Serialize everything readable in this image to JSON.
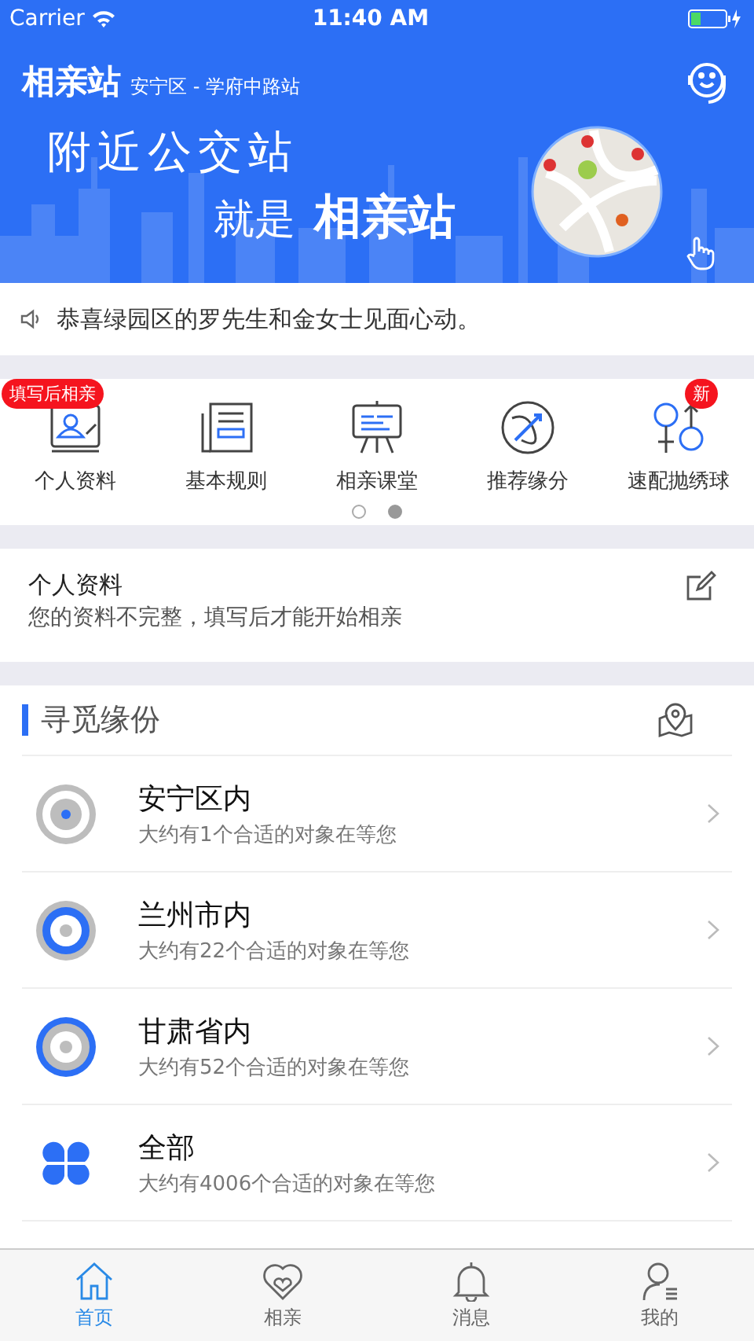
{
  "status_bar": {
    "carrier": "Carrier",
    "time": "11:40 AM"
  },
  "header": {
    "title": "相亲站",
    "location": "安宁区 - 学府中路站"
  },
  "banner": {
    "line_1": "附近公交站",
    "line_2_prefix": "就是",
    "line_2_brand": "相亲站"
  },
  "notice": {
    "text": "恭喜绿园区的罗先生和金女士见面心动。"
  },
  "shortcuts": [
    {
      "label": "个人资料",
      "kind": "profile",
      "badge": "填写后相亲"
    },
    {
      "label": "基本规则",
      "kind": "rules"
    },
    {
      "label": "相亲课堂",
      "kind": "class"
    },
    {
      "label": "推荐缘分",
      "kind": "cupid"
    },
    {
      "label": "速配抛绣球",
      "kind": "gender",
      "badge": "新"
    }
  ],
  "pager": [
    {
      "selected": false
    },
    {
      "selected": true
    }
  ],
  "profile_card": {
    "title": "个人资料",
    "subtitle": "您的资料不完整，填写后才能开始相亲"
  },
  "search_section": {
    "title": "寻觅缘份",
    "items": [
      {
        "title": "安宁区内",
        "subtitle": "大约有1个合适的对象在等您",
        "kind": "district"
      },
      {
        "title": "兰州市内",
        "subtitle": "大约有22个合适的对象在等您",
        "kind": "city"
      },
      {
        "title": "甘肃省内",
        "subtitle": "大约有52个合适的对象在等您",
        "kind": "province"
      },
      {
        "title": "全部",
        "subtitle": "大约有4006个合适的对象在等您",
        "kind": "all"
      }
    ]
  },
  "tab_bar": [
    {
      "label": "首页",
      "kind": "home",
      "selected": true
    },
    {
      "label": "相亲",
      "kind": "heart",
      "selected": false
    },
    {
      "label": "消息",
      "kind": "bell",
      "selected": false
    },
    {
      "label": "我的",
      "kind": "person",
      "selected": false
    }
  ]
}
